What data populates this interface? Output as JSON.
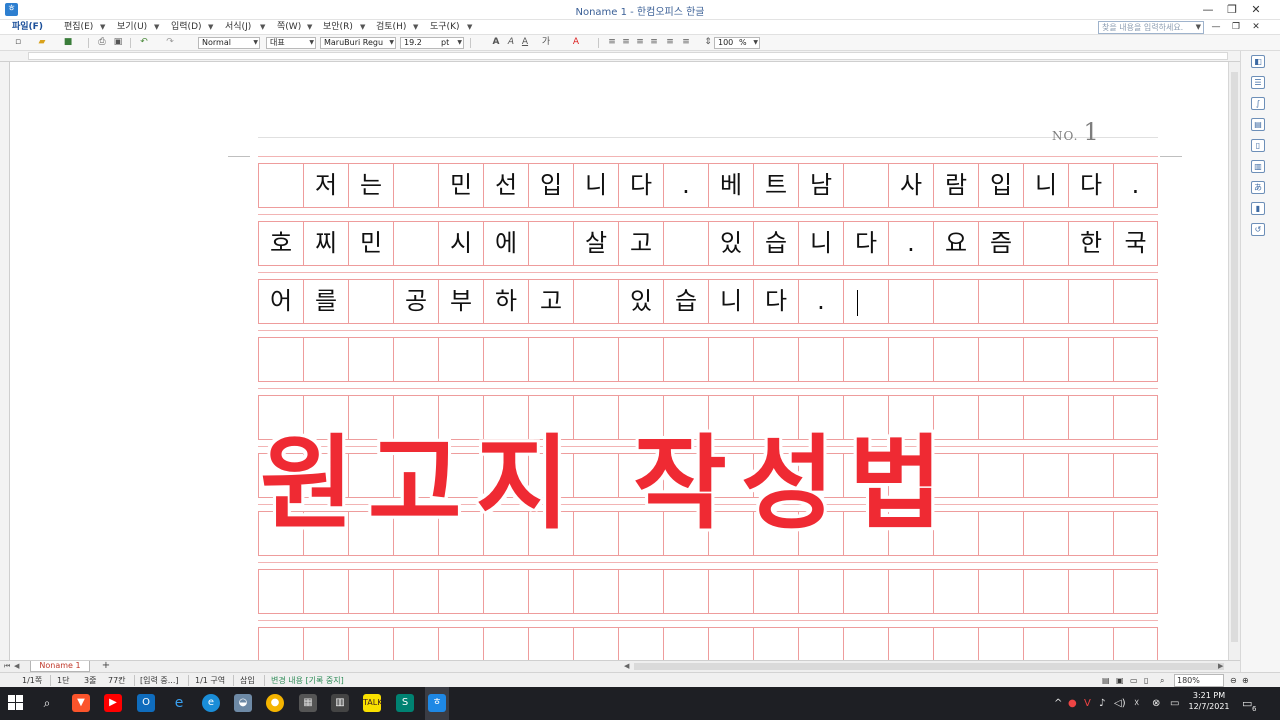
{
  "window": {
    "title": "Noname 1 - 한컴오피스 한글",
    "min": "—",
    "restore": "❐",
    "close": "✕"
  },
  "menu": {
    "items": [
      "파일(F)",
      "편집(E)",
      "보기(U)",
      "입력(D)",
      "서식(J)",
      "쪽(W)",
      "보안(R)",
      "검토(H)",
      "도구(K)"
    ],
    "search_placeholder": "찾을 내용을 입력하세요.",
    "sub_min": "—",
    "sub_restore": "❐",
    "sub_close": "✕"
  },
  "toolbar": {
    "style": "Normal",
    "lang": "대표",
    "font": "MaruBuri Regu",
    "size": "19.2",
    "unit": "pt",
    "zoom": "100",
    "percent": "%",
    "format_icons": [
      "A",
      "A",
      "A",
      "가",
      "A"
    ]
  },
  "document": {
    "page_label": "NO.",
    "page_number": "1",
    "rows": [
      [
        "",
        "저",
        "는",
        "",
        "민",
        "선",
        "입",
        "니",
        "다",
        ".",
        "베",
        "트",
        "남",
        "",
        "사",
        "람",
        "입",
        "니",
        "다",
        "."
      ],
      [
        "호",
        "찌",
        "민",
        "",
        "시",
        "에",
        "",
        "살",
        "고",
        "",
        "있",
        "습",
        "니",
        "다",
        ".",
        "요",
        "즘",
        "",
        "한",
        "국"
      ],
      [
        "어",
        "를",
        "",
        "공",
        "부",
        "하",
        "고",
        "",
        "있",
        "습",
        "니",
        "다",
        ".",
        "",
        "",
        "",
        "",
        "",
        "",
        ""
      ],
      [
        "",
        "",
        "",
        "",
        "",
        "",
        "",
        "",
        "",
        "",
        "",
        "",
        "",
        "",
        "",
        "",
        "",
        "",
        "",
        ""
      ],
      [
        "",
        "",
        "",
        "",
        "",
        "",
        "",
        "",
        "",
        "",
        "",
        "",
        "",
        "",
        "",
        "",
        "",
        "",
        "",
        ""
      ],
      [
        "",
        "",
        "",
        "",
        "",
        "",
        "",
        "",
        "",
        "",
        "",
        "",
        "",
        "",
        "",
        "",
        "",
        "",
        "",
        ""
      ],
      [
        "",
        "",
        "",
        "",
        "",
        "",
        "",
        "",
        "",
        "",
        "",
        "",
        "",
        "",
        "",
        "",
        "",
        "",
        "",
        ""
      ],
      [
        "",
        "",
        "",
        "",
        "",
        "",
        "",
        "",
        "",
        "",
        "",
        "",
        "",
        "",
        "",
        "",
        "",
        "",
        "",
        ""
      ],
      [
        "",
        "",
        "",
        "",
        "",
        "",
        "",
        "",
        "",
        "",
        "",
        "",
        "",
        "",
        "",
        "",
        "",
        "",
        "",
        ""
      ]
    ],
    "overlay_title": "원고지 작성법",
    "grid_color": "#ee9c9c",
    "overlay_color": "#ef2a33"
  },
  "tabs": {
    "doc_tab": "Noname 1",
    "add": "+"
  },
  "status": {
    "items": [
      "1/1쪽",
      "1단",
      "3줄",
      "77칸",
      "[입력 중...]",
      "1/1 구역",
      "삽입",
      "변경 내용 [기록 중지]"
    ],
    "zoom": "180%"
  },
  "taskbar": {
    "time": "3:21 PM",
    "date": "12/7/2021",
    "apps": [
      "search",
      "brave",
      "youtube",
      "outlook",
      "edge-legacy",
      "edge",
      "photos",
      "chrome",
      "calculator",
      "kakaotalk",
      "sway",
      "hwp"
    ],
    "notif_count": "6"
  }
}
